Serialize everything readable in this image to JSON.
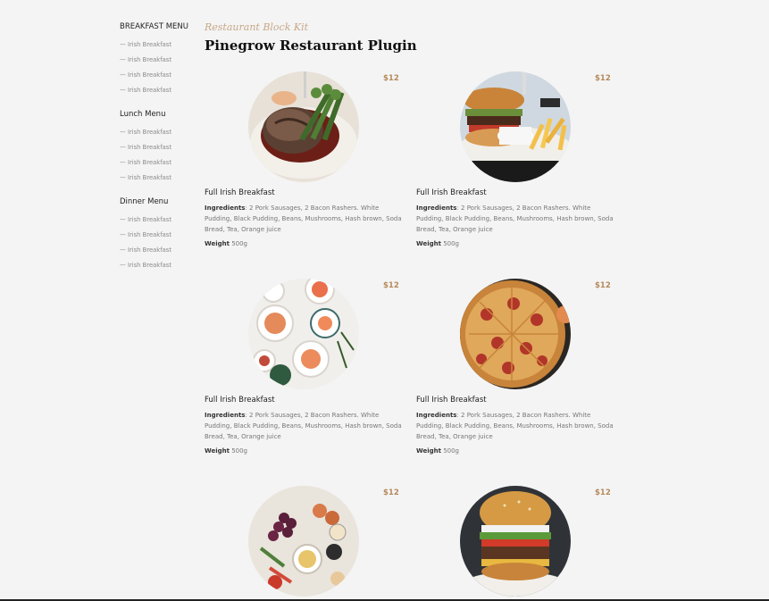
{
  "sidebar": {
    "groups": [
      {
        "heading": "BREAKFAST MENU",
        "items": [
          "— Irish Breakfast",
          "— Irish Breakfast",
          "— Irish Breakfast",
          "— Irish Breakfast"
        ]
      },
      {
        "heading": "Lunch Menu",
        "items": [
          "— Irish Breakfast",
          "— Irish Breakfast",
          "— Irish Breakfast",
          "— Irish Breakfast"
        ]
      },
      {
        "heading": "Dinner Menu",
        "items": [
          "— Irish Breakfast",
          "— Irish Breakfast",
          "— Irish Breakfast",
          "— Irish Breakfast"
        ]
      }
    ]
  },
  "header": {
    "kit_label": "Restaurant Block Kit",
    "title": "Pinegrow Restaurant Plugin"
  },
  "dishes": [
    {
      "price": "$12",
      "name": "Full Irish Breakfast",
      "ingredients_label": "Ingredients",
      "ingredients": ": 2 Pork Sausages, 2 Bacon Rashers. White Pudding, Black Pudding, Beans, Mushrooms, Hash brown, Soda Bread, Tea, Orange juice",
      "weight_label": "Weight",
      "weight": " 500g",
      "image": "steak-icon"
    },
    {
      "price": "$12",
      "name": "Full Irish Breakfast",
      "ingredients_label": "Ingredients",
      "ingredients": ": 2 Pork Sausages, 2 Bacon Rashers. White Pudding, Black Pudding, Beans, Mushrooms, Hash brown, Soda Bread, Tea, Orange juice",
      "weight_label": "Weight",
      "weight": " 500g",
      "image": "burger-fries-icon"
    },
    {
      "price": "$12",
      "name": "Full Irish Breakfast",
      "ingredients_label": "Ingredients",
      "ingredients": ": 2 Pork Sausages, 2 Bacon Rashers. White Pudding, Black Pudding, Beans, Mushrooms, Hash brown, Soda Bread, Tea, Orange juice",
      "weight_label": "Weight",
      "weight": " 500g",
      "image": "plates-table-icon"
    },
    {
      "price": "$12",
      "name": "Full Irish Breakfast",
      "ingredients_label": "Ingredients",
      "ingredients": ": 2 Pork Sausages, 2 Bacon Rashers. White Pudding, Black Pudding, Beans, Mushrooms, Hash brown, Soda Bread, Tea, Orange juice",
      "weight_label": "Weight",
      "weight": " 500g",
      "image": "pizza-icon"
    },
    {
      "price": "$12",
      "name": "",
      "ingredients_label": "",
      "ingredients": "",
      "weight_label": "",
      "weight": "",
      "image": "platter-icon"
    },
    {
      "price": "$12",
      "name": "",
      "ingredients_label": "",
      "ingredients": "",
      "weight_label": "",
      "weight": "",
      "image": "tall-burger-icon"
    }
  ],
  "colors": {
    "background": "#f4f4f4",
    "accent_price": "#b58a5c",
    "kit_label": "#c8a789",
    "title": "#111111"
  }
}
